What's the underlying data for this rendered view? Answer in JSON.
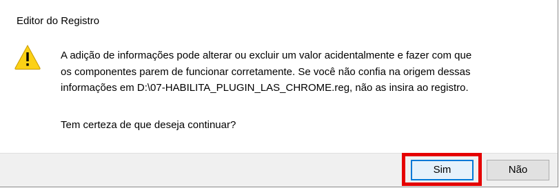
{
  "dialog": {
    "title": "Editor do Registro",
    "icon": "warning-icon",
    "message_lines": [
      "A adição de informações pode alterar ou excluir um valor acidentalmente e fazer com que",
      "os componentes parem de funcionar corretamente. Se você não confia na origem dessas",
      "informações em D:\\07-HABILITA_PLUGIN_LAS_CHROME.reg, não as insira ao registro."
    ],
    "question": "Tem certeza de que deseja continuar?",
    "buttons": {
      "yes_label": "Sim",
      "no_label": "Não"
    }
  },
  "colors": {
    "highlight": "#e50000",
    "focus_border": "#0078d7",
    "warning_fill": "#fcd116"
  }
}
